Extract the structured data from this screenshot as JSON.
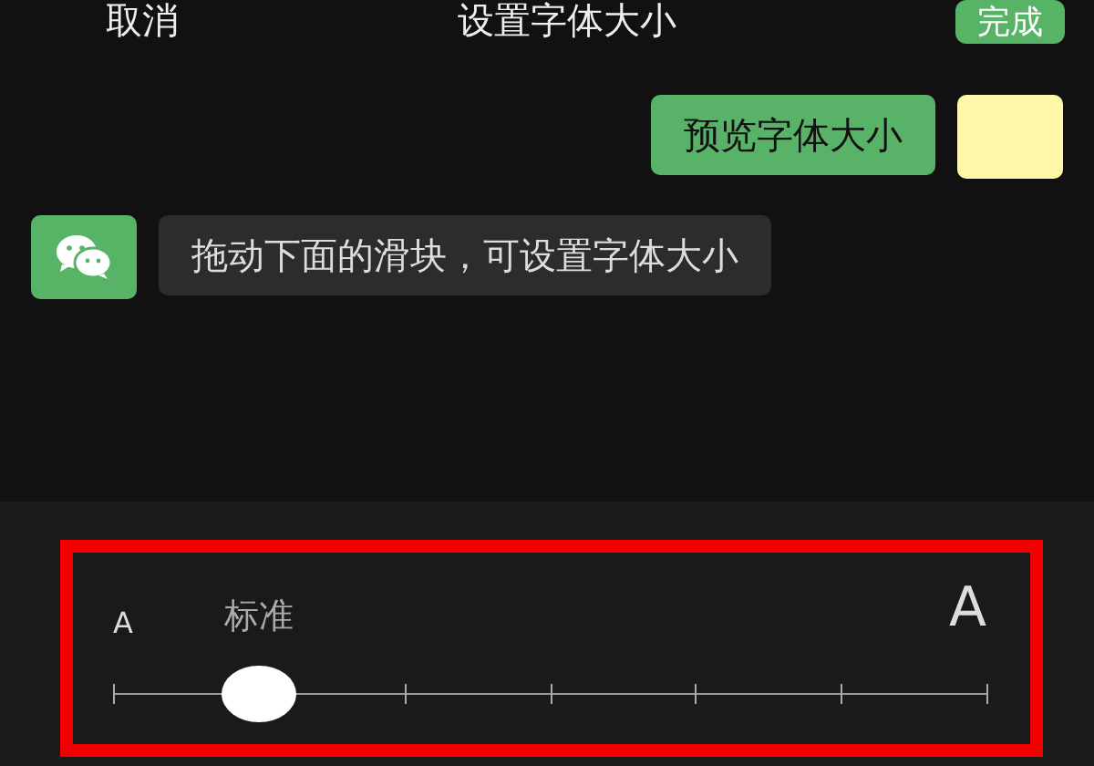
{
  "header": {
    "cancel": "取消",
    "title": "设置字体大小",
    "done": "完成"
  },
  "messages": [
    {
      "kind": "sent",
      "text": "预览字体大小"
    },
    {
      "kind": "received",
      "text": "拖动下面的滑块，可设置字体大小"
    }
  ],
  "font_slider": {
    "small_label": "A",
    "large_label": "A",
    "current_label": "标准",
    "level": 0.1667,
    "highlighted": true
  }
}
